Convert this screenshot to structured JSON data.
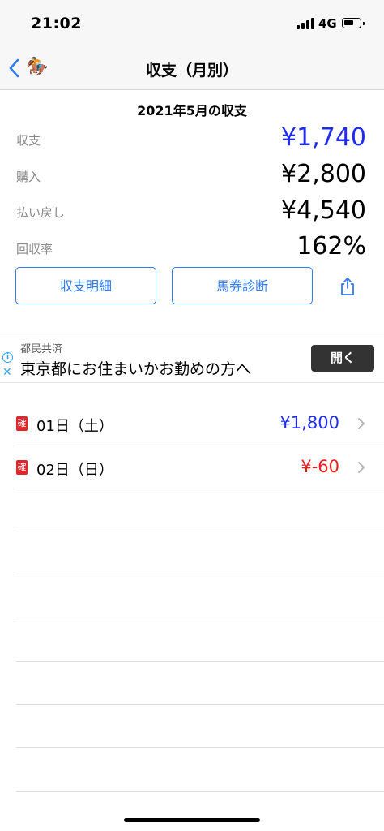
{
  "status_bar": {
    "time": "21:02",
    "network": "4G"
  },
  "nav": {
    "back_icon": "chevron-left-icon",
    "app_icon": "horse-jockey-icon",
    "title": "収支（月別）"
  },
  "summary": {
    "month_title": "2021年5月の収支",
    "rows": [
      {
        "label": "収支",
        "value": "¥1,740",
        "color": "#1f2cf0"
      },
      {
        "label": "購入",
        "value": "¥2,800",
        "color": "#000000"
      },
      {
        "label": "払い戻し",
        "value": "¥4,540",
        "color": "#000000"
      },
      {
        "label": "回収率",
        "value": "162%",
        "color": "#000000"
      }
    ]
  },
  "actions": {
    "detail_label": "収支明細",
    "diagnosis_label": "馬券診断",
    "share_icon": "share-icon"
  },
  "ad": {
    "sponsor": "都民共済",
    "headline": "東京都にお住まいかお勤めの方へ",
    "button_label": "開く"
  },
  "days": [
    {
      "badge": "確",
      "date": "01日（土）",
      "amount": "¥1,800",
      "color": "#1f2cf0"
    },
    {
      "badge": "確",
      "date": "02日（日）",
      "amount": "¥-60",
      "color": "#ee1c1c"
    }
  ],
  "colors": {
    "accent": "#2f7cf6",
    "positive": "#1f2cf0",
    "negative": "#ee1c1c",
    "badge": "#e1262b"
  }
}
